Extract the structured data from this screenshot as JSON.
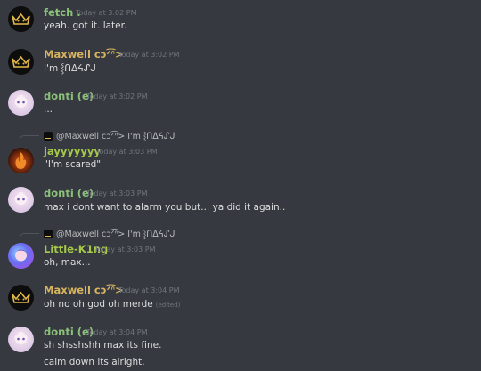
{
  "colors": {
    "background": "#36393f",
    "fetch_name": "#8bc07a",
    "maxwell_name": "#d8b45e",
    "donti_name": "#8bc07a",
    "jay_name": "#a6c94a",
    "little_name": "#a6c94a",
    "timestamp": "#72767d"
  },
  "messages": [
    {
      "author": "fetch .",
      "time": "Today at 3:02 PM",
      "lines": [
        "yeah. got it. later."
      ],
      "avatar_icon": "crown-icon"
    },
    {
      "author": "Maxwell cↄᐟ͡ᐢ>",
      "time": "Today at 3:02 PM",
      "lines": [
        "I'm ⸾ᑎᐃᔦᔑᒍ"
      ],
      "avatar_icon": "crown-icon"
    },
    {
      "author": "donti (e)",
      "time": "Today at 3:02 PM",
      "lines": [
        "..."
      ],
      "avatar_icon": "anime-avatar"
    },
    {
      "reply_to": "@Maxwell cↄᐟ͡ᐢ> I'm ⸾ᑎᐃᔦᔑᒍ",
      "author": "jayyyyyyy",
      "time": "Today at 3:03 PM",
      "lines": [
        "\"I'm scared\""
      ],
      "avatar_icon": "fire-avatar"
    },
    {
      "author": "donti (e)",
      "time": "Today at 3:03 PM",
      "lines": [
        "max i dont want to alarm you but... ya did it again.."
      ],
      "avatar_icon": "anime-avatar"
    },
    {
      "reply_to": "@Maxwell cↄᐟ͡ᐢ> I'm ⸾ᑎᐃᔦᔑᒍ",
      "author": "Little-K1ng",
      "time": "Today at 3:03 PM",
      "lines": [
        "oh, max..."
      ],
      "avatar_icon": "anime-avatar"
    },
    {
      "author": "Maxwell cↄᐟ͡ᐢ>",
      "time": "Today at 3:04 PM",
      "lines": [
        "oh no oh god oh merde"
      ],
      "edited": "(edited)",
      "avatar_icon": "crown-icon"
    },
    {
      "author": "donti (e)",
      "time": "Today at 3:04 PM",
      "lines": [
        "sh shsshshh max its fine.",
        "calm down its alright."
      ],
      "avatar_icon": "anime-avatar"
    }
  ]
}
